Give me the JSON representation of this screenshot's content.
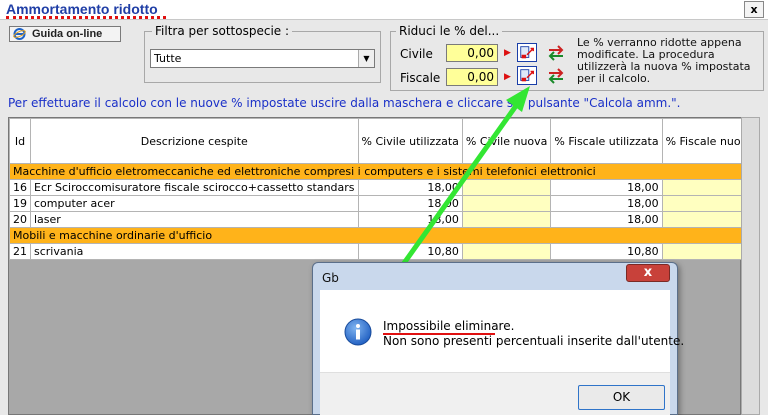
{
  "window": {
    "title": "Ammortamento ridotto",
    "close": "x"
  },
  "help_button": {
    "label": "Guida on-line"
  },
  "filter": {
    "label": "Filtra per sottospecie :",
    "value": "Tutte"
  },
  "reduce": {
    "label": "Riduci le % del...",
    "civile": {
      "label": "Civile",
      "value": "0,00"
    },
    "fiscale": {
      "label": "Fiscale",
      "value": "0,00"
    },
    "note": "Le % verranno ridotte appena modificate. La procedura utilizzerà la nuova % impostata per il calcolo."
  },
  "instruction": "Per effettuare il calcolo con le nuove % impostate uscire dalla maschera e cliccare sul pulsante \"Calcola amm.\".",
  "table": {
    "columns": [
      "Id",
      "Descrizione cespite",
      "% Civile utilizzata",
      "% Civile nuova",
      "% Fiscale utilizzata",
      "% Fiscale nuova"
    ],
    "rows": [
      {
        "type": "category",
        "text": "Macchine d'ufficio eletromeccaniche ed elettroniche compresi i computers e i sistemi telefonici elettronici"
      },
      {
        "type": "item",
        "id": "16",
        "desc": "Ecr Sciroccomisuratore fiscale scirocco+cassetto standars",
        "civ_used": "18,00",
        "civ_new": "",
        "fis_used": "18,00",
        "fis_new": ""
      },
      {
        "type": "item",
        "id": "19",
        "desc": "computer acer",
        "civ_used": "18,00",
        "civ_new": "",
        "fis_used": "18,00",
        "fis_new": ""
      },
      {
        "type": "item",
        "id": "20",
        "desc": "laser",
        "civ_used": "18,00",
        "civ_new": "",
        "fis_used": "18,00",
        "fis_new": ""
      },
      {
        "type": "category",
        "text": "Mobili e macchine ordinarie d'ufficio"
      },
      {
        "type": "item",
        "id": "21",
        "desc": "scrivania",
        "civ_used": "10,80",
        "civ_new": "",
        "fis_used": "10,80",
        "fis_new": ""
      }
    ]
  },
  "dialog": {
    "title": "Gb",
    "close": "x",
    "message_title": "Impossibile eliminare.",
    "message_body": "Non sono presenti percentuali inserite dall'utente.",
    "ok_label": "OK"
  },
  "colors": {
    "accent_title": "#1f3ea6",
    "input_yellow": "#ffff99",
    "category_orange": "#ffb31a",
    "highlight_red": "#e01010",
    "arrow_green": "#33e633"
  }
}
